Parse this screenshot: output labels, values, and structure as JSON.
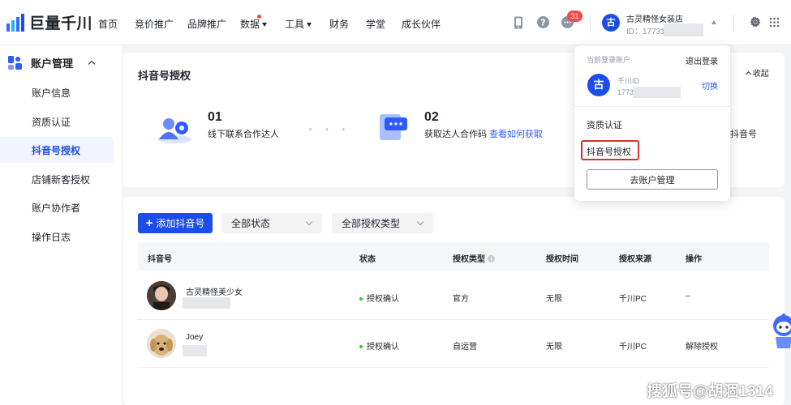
{
  "brand": {
    "name": "巨量千川"
  },
  "nav": {
    "items": [
      "首页",
      "竞价推广",
      "品牌推广",
      "数据",
      "工具",
      "财务",
      "学堂",
      "成长伙伴"
    ],
    "badge_count": "31"
  },
  "account": {
    "avatar_char": "古",
    "name": "古灵精怪女装店",
    "id_label": "ID：177317"
  },
  "sidebar": {
    "group_label": "账户管理",
    "items": [
      "账户信息",
      "资质认证",
      "抖音号授权",
      "店铺新客授权",
      "账户协作者",
      "操作日志"
    ],
    "active_index": 2
  },
  "auth_card": {
    "title": "抖音号授权",
    "collapse_label": "收起",
    "steps": [
      {
        "num": "01",
        "text": "线下联系合作达人"
      },
      {
        "num": "02",
        "text": "获取达人合作码",
        "link": "查看如何获取"
      },
      {
        "text": "抖音号"
      }
    ]
  },
  "toolbar": {
    "add_button": "添加抖音号",
    "status_filter": "全部状态",
    "type_filter": "全部授权类型"
  },
  "table": {
    "columns": [
      "抖音号",
      "状态",
      "授权类型",
      "授权时间",
      "授权来源",
      "操作"
    ],
    "rows": [
      {
        "name": "古灵精怪美少女",
        "status": "授权确认",
        "type": "官方",
        "time": "无限",
        "source": "千川PC",
        "action": "–"
      },
      {
        "name": "Joey",
        "status": "授权确认",
        "type": "自运营",
        "time": "无限",
        "source": "千川PC",
        "action": "解除授权"
      }
    ]
  },
  "popup": {
    "current_label": "当前登录账户",
    "logout_label": "退出登录",
    "avatar_char": "古",
    "qianchuan_id_label": "千川ID",
    "id_prefix": "1773",
    "switch_label": "切换",
    "menu": [
      "资质认证",
      "抖音号授权"
    ],
    "manage_button": "去账户管理"
  },
  "watermark": "搜狐号@胡涸1314",
  "colors": {
    "accent": "#1d4de8",
    "status_green": "#34c724",
    "badge_red": "#f54a45",
    "annotation_red": "#d6322b"
  }
}
